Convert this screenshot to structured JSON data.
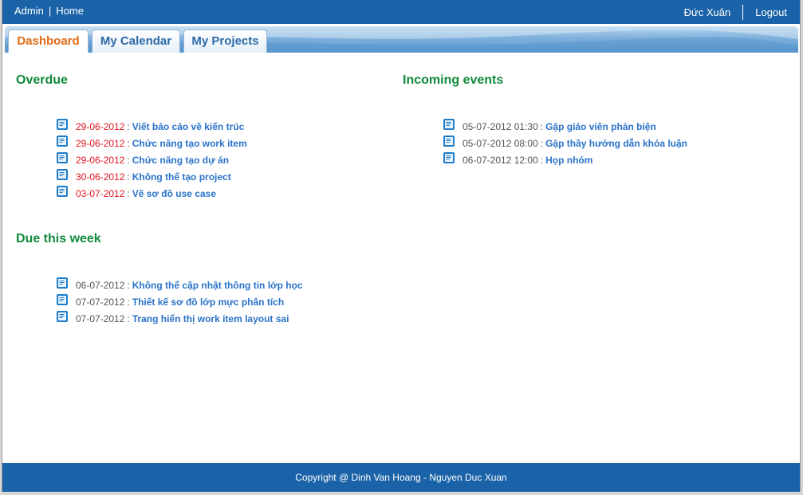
{
  "topbar": {
    "admin_link": "Admin",
    "separator": "|",
    "home_link": "Home",
    "user_name": "Đức Xuân",
    "logout_link": "Logout"
  },
  "tabs": [
    {
      "label": "Dashboard",
      "active": true
    },
    {
      "label": "My Calendar",
      "active": false
    },
    {
      "label": "My Projects",
      "active": false
    }
  ],
  "overdue": {
    "title": "Overdue",
    "items": [
      {
        "date": "29-06-2012",
        "title": "Viết báo cáo về kiến trúc"
      },
      {
        "date": "29-06-2012",
        "title": "Chức năng tạo work item"
      },
      {
        "date": "29-06-2012",
        "title": "Chức năng tạo dự án"
      },
      {
        "date": "30-06-2012",
        "title": "Không thể tạo project"
      },
      {
        "date": "03-07-2012",
        "title": "Vẽ sơ đồ use case"
      }
    ]
  },
  "due_this_week": {
    "title": "Due this week",
    "items": [
      {
        "date": "06-07-2012",
        "title": "Không thể cập nhật thông tin lớp học"
      },
      {
        "date": "07-07-2012",
        "title": "Thiết kế sơ đồ lớp mực phân tích"
      },
      {
        "date": "07-07-2012",
        "title": "Trang hiển thị work item layout sai"
      }
    ]
  },
  "incoming_events": {
    "title": "Incoming events",
    "items": [
      {
        "date": "05-07-2012 01:30",
        "title": "Gặp giáo viên phản biện"
      },
      {
        "date": "05-07-2012 08:00",
        "title": "Gặp thầy hướng dẫn khóa luận"
      },
      {
        "date": "06-07-2012 12:00",
        "title": "Họp nhóm"
      }
    ]
  },
  "footer": {
    "copyright": "Copyright @ Dinh Van Hoang - Nguyen Duc Xuan"
  },
  "colors": {
    "header_blue": "#1b63a8",
    "section_green": "#118a3c",
    "overdue_red": "#e0141e",
    "link_blue": "#2a73c9",
    "active_tab_orange": "#e06a14"
  },
  "icons": {
    "item_icon": "document-icon"
  }
}
